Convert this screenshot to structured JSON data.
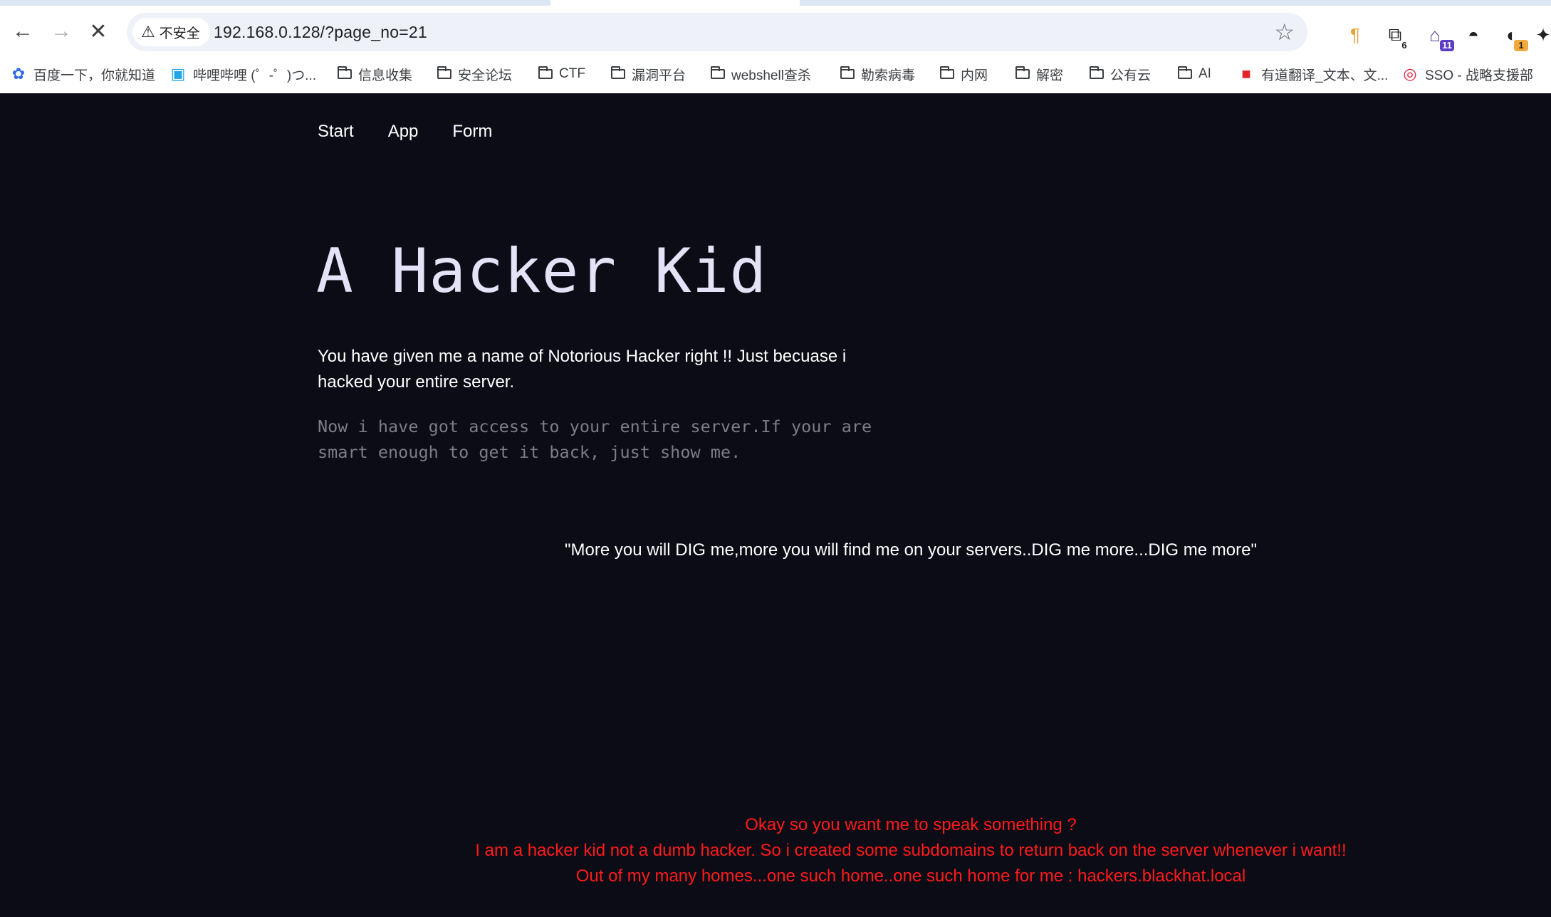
{
  "browser": {
    "security_label": "不安全",
    "url": "192.168.0.128/?page_no=21",
    "extensions": [
      {
        "name": "pilcrow-extension-icon",
        "glyph": "¶",
        "badge": ""
      },
      {
        "name": "capture-extension-icon",
        "glyph": "⧉",
        "badge": "6"
      },
      {
        "name": "house-extension-icon",
        "glyph": "⌂",
        "badge": "11"
      },
      {
        "name": "hat-extension-icon",
        "glyph": "◓",
        "badge": ""
      },
      {
        "name": "ring-extension-icon",
        "glyph": "◐",
        "badge": "1"
      },
      {
        "name": "puzzle-extension-icon",
        "glyph": "✦",
        "badge": ""
      }
    ],
    "bookmarks": [
      {
        "label": "百度一下，你就知道",
        "icon": "paw-icon"
      },
      {
        "label": "哔哩哔哩 (゜-゜)つ...",
        "icon": "bilibili-icon"
      },
      {
        "label": "信息收集",
        "icon": "folder-icon"
      },
      {
        "label": "安全论坛",
        "icon": "folder-icon"
      },
      {
        "label": "CTF",
        "icon": "folder-icon"
      },
      {
        "label": "漏洞平台",
        "icon": "folder-icon"
      },
      {
        "label": "webshell查杀",
        "icon": "folder-icon"
      },
      {
        "label": "勒索病毒",
        "icon": "folder-icon"
      },
      {
        "label": "内网",
        "icon": "folder-icon"
      },
      {
        "label": "解密",
        "icon": "folder-icon"
      },
      {
        "label": "公有云",
        "icon": "folder-icon"
      },
      {
        "label": "AI",
        "icon": "folder-icon"
      },
      {
        "label": "有道翻译_文本、文...",
        "icon": "youdao-icon"
      },
      {
        "label": "SSO - 战略支援部",
        "icon": "sso-icon"
      }
    ]
  },
  "page": {
    "nav": [
      "Start",
      "App",
      "Form"
    ],
    "title": "A Hacker Kid",
    "lead": "You have given me a name of Notorious Hacker right !! Just becuase i hacked your entire server.",
    "mono": "Now i have got access to your entire server.If your are smart enough to get it back, just show me.",
    "quote": "\"More you will DIG me,more you will find me on your servers..DIG me more...DIG me more\"",
    "red_lines": [
      "Okay so you want me to speak something ?",
      "I am a hacker kid not a dumb hacker. So i created some subdomains to return back on the server whenever i want!!",
      "Out of my many homes...one such home..one such home for me : hackers.blackhat.local"
    ]
  },
  "colors": {
    "page_background": "#0b0c16",
    "title_color": "#e4e2f6",
    "muted_text": "#7d7d87",
    "red_text": "#ff1a1a"
  }
}
